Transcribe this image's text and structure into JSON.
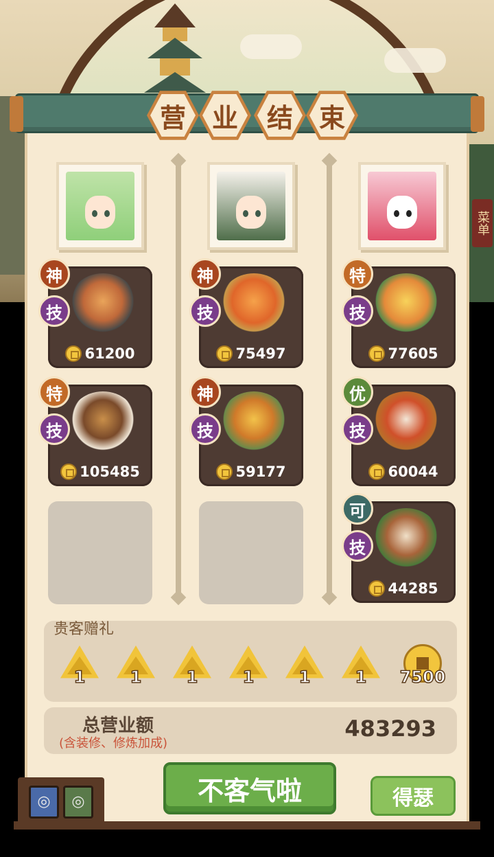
{
  "title_chars": [
    "营",
    "业",
    "结",
    "束"
  ],
  "side_menu": "菜单",
  "columns": [
    {
      "dishes": [
        {
          "badges": [
            "神",
            "技"
          ],
          "price": "61200"
        },
        {
          "badges": [
            "特",
            "技"
          ],
          "price": "105485"
        }
      ]
    },
    {
      "dishes": [
        {
          "badges": [
            "神",
            "技"
          ],
          "price": "75497"
        },
        {
          "badges": [
            "神",
            "技"
          ],
          "price": "59177"
        }
      ]
    },
    {
      "dishes": [
        {
          "badges": [
            "特",
            "技"
          ],
          "price": "77605"
        },
        {
          "badges": [
            "优",
            "技"
          ],
          "price": "60044"
        },
        {
          "badges": [
            "可",
            "技"
          ],
          "price": "44285"
        }
      ]
    }
  ],
  "gifts": {
    "title": "贵客赠礼",
    "items": [
      "1",
      "1",
      "1",
      "1",
      "1",
      "1"
    ],
    "gold": "7500"
  },
  "total": {
    "label": "总营业额",
    "sub": "(含装修、修炼加成)",
    "value": "483293"
  },
  "buttons": {
    "main": "不客气啦",
    "side": "得瑟"
  },
  "colors": {
    "header_teal": "#4f7a6c",
    "panel_cream": "#f7ead2",
    "button_green": "#6cae4a",
    "dish_card": "#4e3b33"
  }
}
